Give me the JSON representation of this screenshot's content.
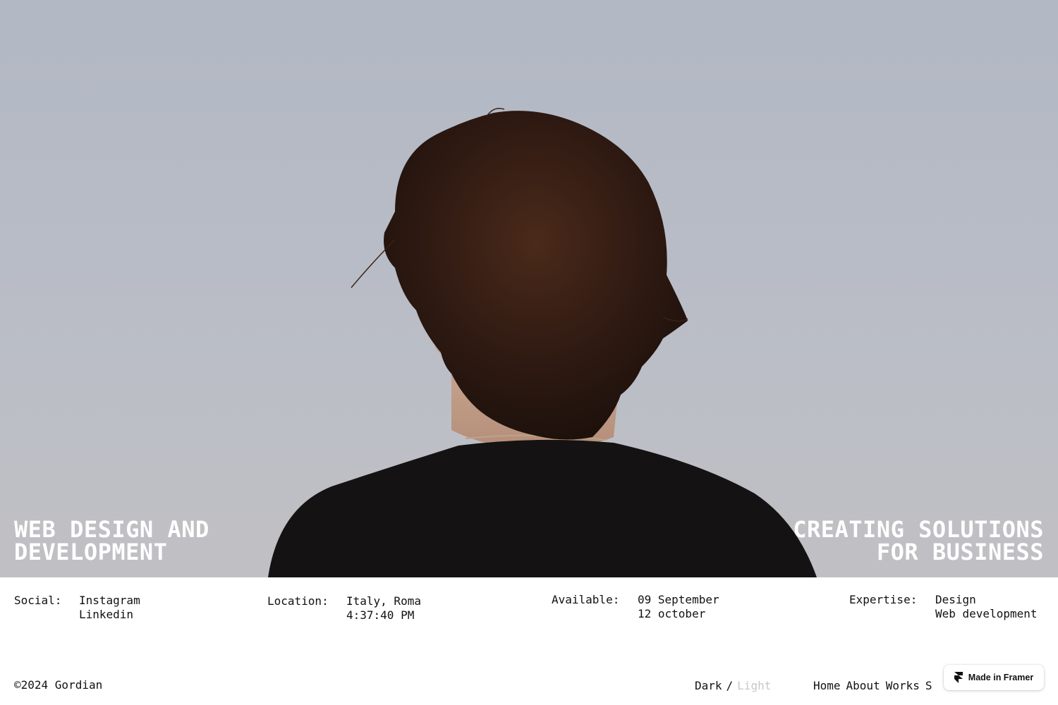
{
  "hero": {
    "left_line1": "WEB DESIGN AND",
    "left_line2": "DEVELOPMENT",
    "right_line1": "CREATING SOLUTIONS",
    "right_line2": "FOR BUSINESS"
  },
  "info": {
    "social": {
      "label": "Social:",
      "items": [
        "Instagram",
        "Linkedin"
      ]
    },
    "location": {
      "label": "Location:",
      "place": "Italy, Roma",
      "time": "4:37:40 PM"
    },
    "available": {
      "label": "Available:",
      "lines": [
        "09 September",
        "12 october"
      ]
    },
    "expertise": {
      "label": "Expertise:",
      "items": [
        "Design",
        "Web development"
      ]
    }
  },
  "footer": {
    "copyright": "©2024 Gordian",
    "theme": {
      "dark": "Dark",
      "separator": "/",
      "light": "Light"
    },
    "nav": [
      "Home",
      "About",
      "Works",
      "S"
    ],
    "framer_badge": "Made in Framer"
  },
  "colors": {
    "sky": "#b6bbc5",
    "hair": "#3a2116",
    "sweater": "#141213",
    "hero_text": "#ffffff",
    "inactive_text": "#c8c8c8"
  },
  "icons": {
    "framer": "framer-logo-icon"
  }
}
